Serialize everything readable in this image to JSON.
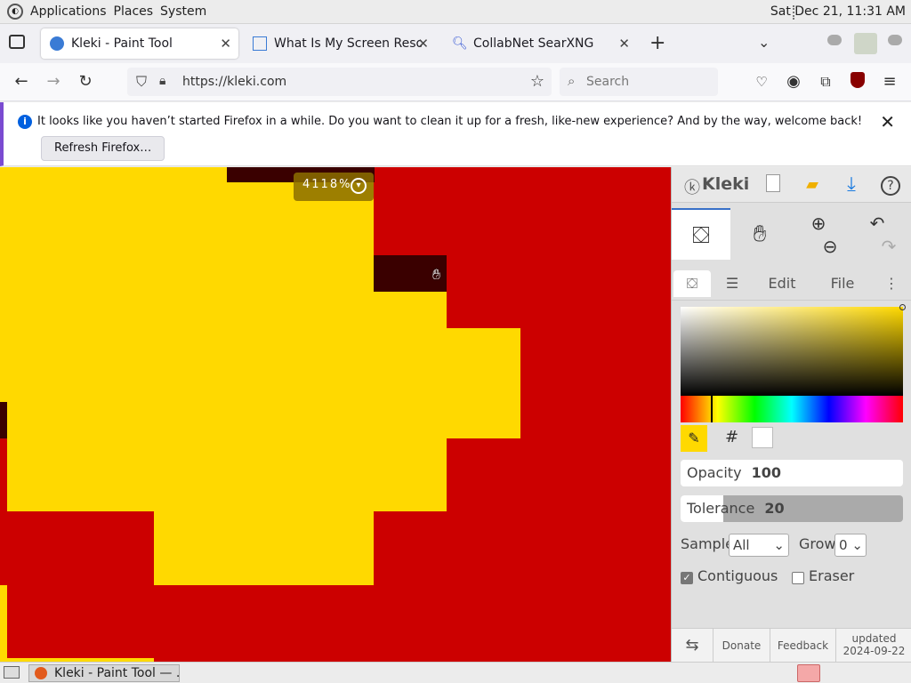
{
  "system": {
    "menu": [
      "Applications",
      "Places",
      "System"
    ],
    "clock": "Sat Dec 21, 11:31 AM"
  },
  "tabs": [
    {
      "title": "Kleki - Paint Tool",
      "active": true
    },
    {
      "title": "What Is My Screen Resolutio",
      "active": false
    },
    {
      "title": "CollabNet SearXNG",
      "active": false
    }
  ],
  "nav": {
    "url": "https://kleki.com",
    "search_placeholder": "Search"
  },
  "notice": {
    "message": "It looks like you haven’t started Firefox in a while. Do you want to clean it up for a fresh, like-new experience? And by the way, welcome back!",
    "button": "Refresh Firefox…"
  },
  "canvas": {
    "zoom_label": "4118%"
  },
  "kleki": {
    "brand": "Kleki",
    "tabs": [
      "Edit",
      "File"
    ],
    "hex_label": "#",
    "opacity_label": "Opacity",
    "opacity_value": "100",
    "tolerance_label": "Tolerance",
    "tolerance_value": "20",
    "sample_label": "Sample",
    "sample_value": "All",
    "grow_label": "Grow",
    "grow_value": "0",
    "contiguous_label": "Contiguous",
    "contiguous_checked": true,
    "eraser_label": "Eraser",
    "eraser_checked": false,
    "donate": "Donate",
    "feedback": "Feedback",
    "updated_line1": "updated",
    "updated_line2": "2024-09-22"
  },
  "colors": {
    "primary": "#ffd900",
    "secondary": "#cc0000",
    "dark": "#3a0000"
  },
  "taskbar": {
    "task": "Kleki - Paint Tool — ..."
  }
}
